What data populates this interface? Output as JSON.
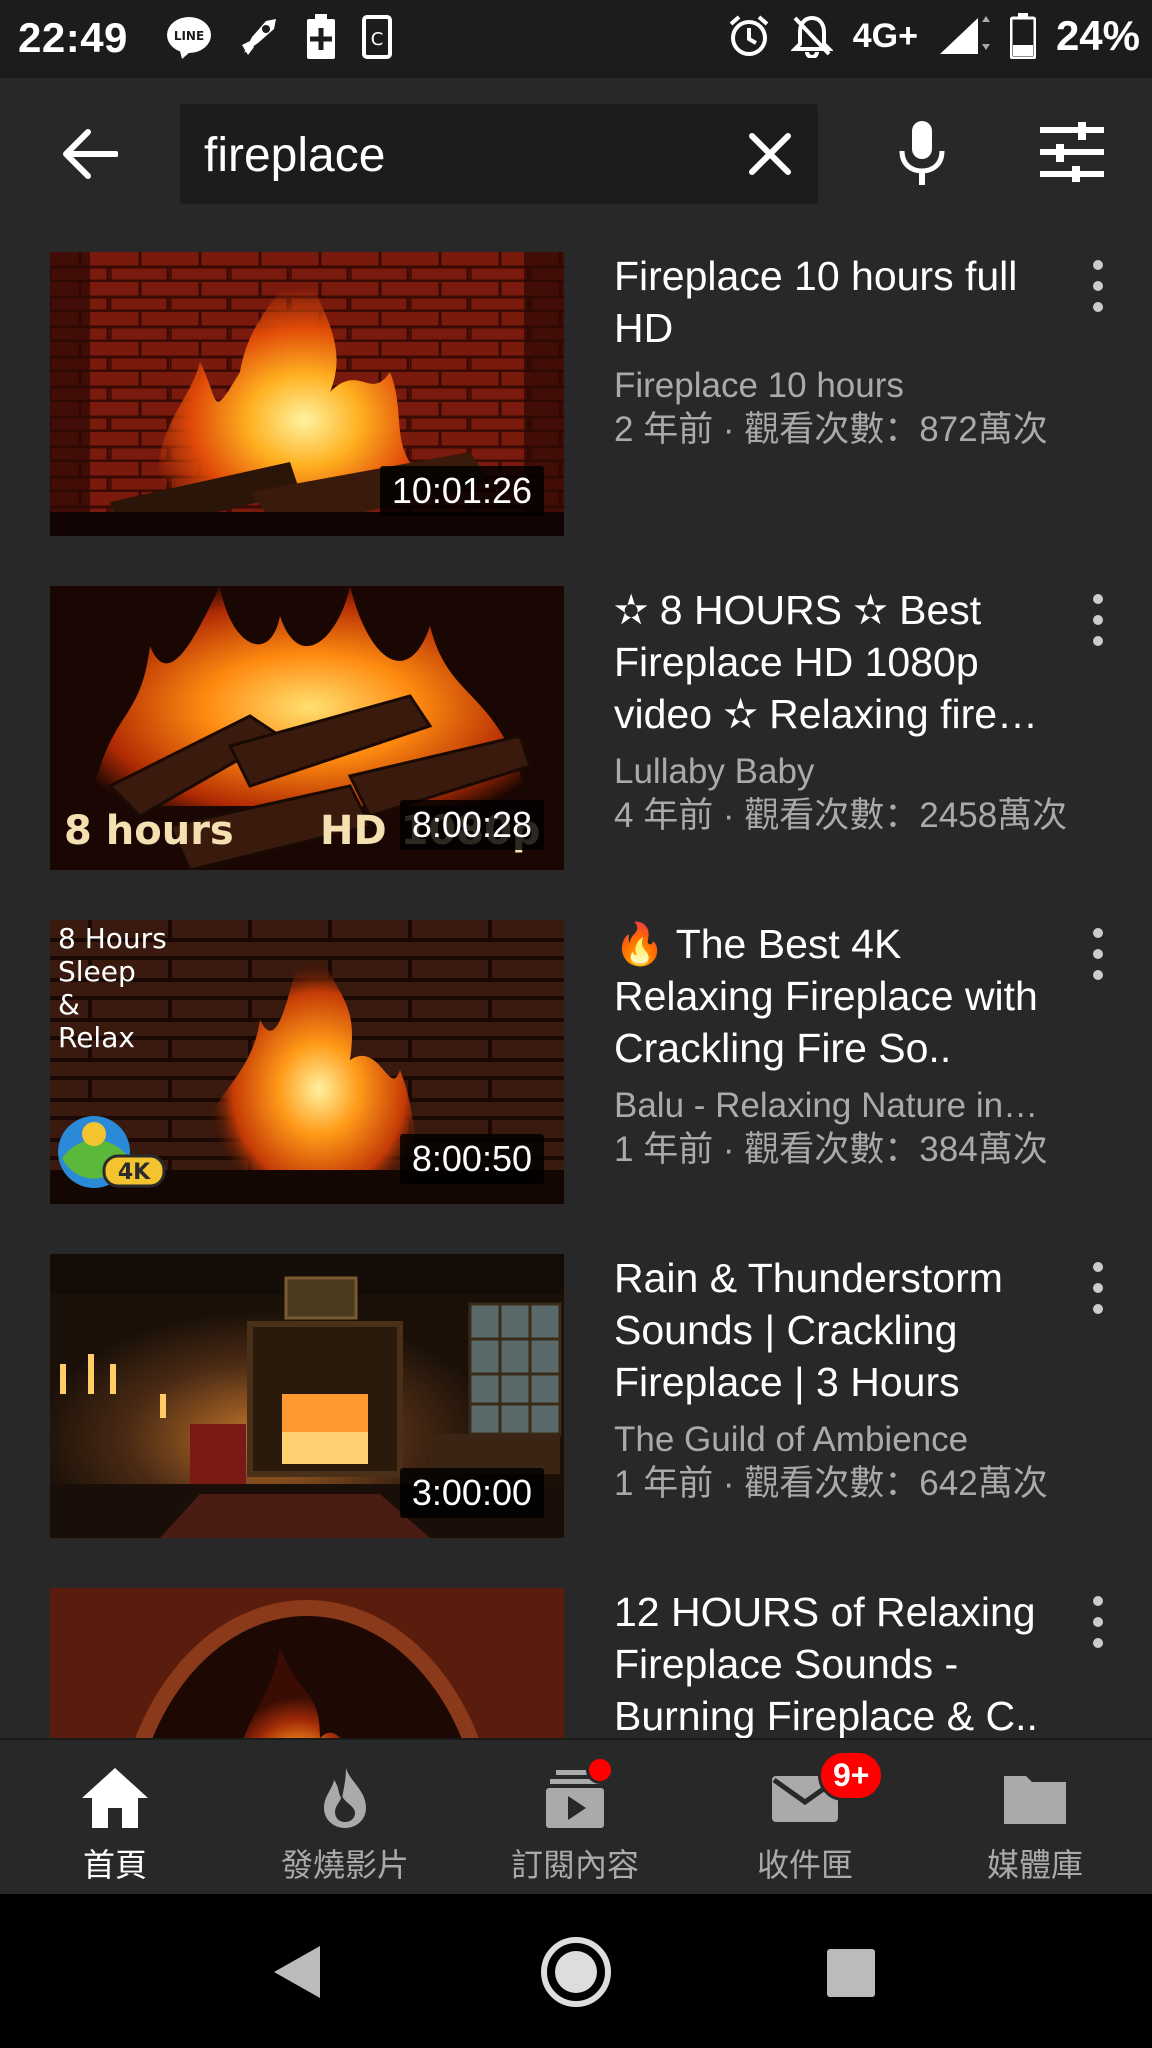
{
  "status_bar": {
    "time": "22:49",
    "network": "4G+",
    "battery": "24%",
    "icons": [
      "line-icon",
      "rocket-icon",
      "battery-plus-icon",
      "clipboard-icon",
      "alarm-icon",
      "bell-off-icon",
      "signal-icon",
      "battery-icon"
    ]
  },
  "search": {
    "query": "fireplace",
    "icons": {
      "back": "arrow-back-icon",
      "clear": "close-icon",
      "voice": "mic-icon",
      "filter": "filter-icon"
    }
  },
  "results": [
    {
      "title": "Fireplace 10 hours full HD",
      "channel": "Fireplace 10 hours",
      "stats": "2 年前 · 觀看次數：872萬次",
      "duration": "10:01:26",
      "overlay_lines": [],
      "overlay_left": "",
      "overlay_right": ""
    },
    {
      "title": "✫ 8 HOURS ✫ Best Fireplace HD 1080p video ✫ Relaxing fire…",
      "channel": "Lullaby Baby",
      "stats": "4 年前 · 觀看次數：2458萬次",
      "duration": "8:00:28",
      "overlay_lines": [],
      "overlay_left": "8 hours",
      "overlay_right": "HD 1080p"
    },
    {
      "title": "🔥 The Best 4K Relaxing Fireplace with Crackling Fire So..",
      "channel": "Balu - Relaxing Nature in…",
      "stats": "1 年前 · 觀看次數：384萬次",
      "duration": "8:00:50",
      "overlay_lines": [
        "8 Hours",
        "Sleep",
        "&",
        "Relax"
      ],
      "overlay_left": "",
      "overlay_right": "4K"
    },
    {
      "title": "Rain & Thunderstorm Sounds | Crackling Fireplace | 3 Hours",
      "channel": "The Guild of Ambience",
      "stats": "1 年前 · 觀看次數：642萬次",
      "duration": "3:00:00",
      "overlay_lines": [],
      "overlay_left": "",
      "overlay_right": ""
    },
    {
      "title": "12 HOURS of Relaxing Fireplace Sounds - Burning Fireplace & C..",
      "channel": "",
      "stats": "",
      "duration": "",
      "overlay_lines": [],
      "overlay_left": "",
      "overlay_right": ""
    }
  ],
  "bottom_nav": [
    {
      "label": "首頁",
      "icon": "home-icon",
      "active": true
    },
    {
      "label": "發燒影片",
      "icon": "flame-icon",
      "active": false
    },
    {
      "label": "訂閱內容",
      "icon": "subscriptions-icon",
      "active": false,
      "badge_dot": true
    },
    {
      "label": "收件匣",
      "icon": "mail-icon",
      "active": false,
      "badge": "9+"
    },
    {
      "label": "媒體庫",
      "icon": "folder-icon",
      "active": false
    }
  ],
  "system_nav": {
    "icons": [
      "back-triangle-icon",
      "home-circle-icon",
      "recents-square-icon"
    ]
  },
  "colors": {
    "background": "#282828",
    "header": "#282828",
    "search_box": "#1c1c1c",
    "badge": "#ff0000",
    "meta_text": "#aaaaaa"
  }
}
